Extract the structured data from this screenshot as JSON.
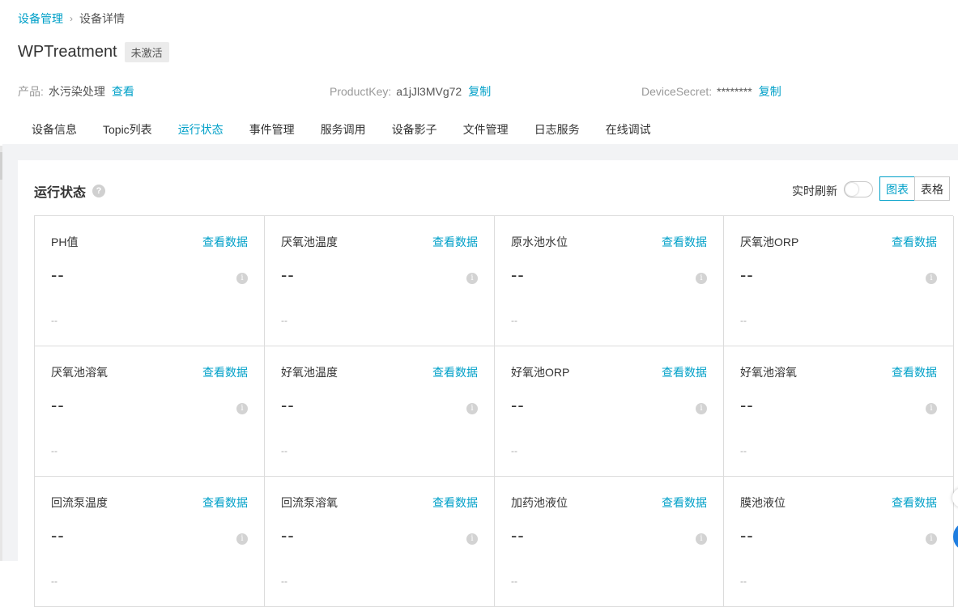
{
  "breadcrumb": {
    "parent": "设备管理",
    "current": "设备详情"
  },
  "device": {
    "name": "WPTreatment",
    "status": "未激活"
  },
  "meta": {
    "product_label": "产品:",
    "product_value": "水污染处理",
    "product_link": "查看",
    "productkey_label": "ProductKey:",
    "productkey_value": "a1jJl3MVg72",
    "productkey_link": "复制",
    "secret_label": "DeviceSecret:",
    "secret_value": "********",
    "secret_link": "复制"
  },
  "tabs": [
    {
      "label": "设备信息"
    },
    {
      "label": "Topic列表"
    },
    {
      "label": "运行状态"
    },
    {
      "label": "事件管理"
    },
    {
      "label": "服务调用"
    },
    {
      "label": "设备影子"
    },
    {
      "label": "文件管理"
    },
    {
      "label": "日志服务"
    },
    {
      "label": "在线调试"
    }
  ],
  "active_tab": 2,
  "section": {
    "title": "运行状态",
    "help_icon": "?",
    "refresh_label": "实时刷新",
    "refresh_on": false,
    "view_chart": "图表",
    "view_table": "表格"
  },
  "card_action": "查看数据",
  "cards": [
    {
      "name": "PH值",
      "value": "--",
      "sub": "--"
    },
    {
      "name": "厌氧池温度",
      "value": "--",
      "sub": "--"
    },
    {
      "name": "原水池水位",
      "value": "--",
      "sub": "--"
    },
    {
      "name": "厌氧池ORP",
      "value": "--",
      "sub": "--"
    },
    {
      "name": "厌氧池溶氧",
      "value": "--",
      "sub": "--"
    },
    {
      "name": "好氧池温度",
      "value": "--",
      "sub": "--"
    },
    {
      "name": "好氧池ORP",
      "value": "--",
      "sub": "--"
    },
    {
      "name": "好氧池溶氧",
      "value": "--",
      "sub": "--"
    },
    {
      "name": "回流泵温度",
      "value": "--",
      "sub": "--"
    },
    {
      "name": "回流泵溶氧",
      "value": "--",
      "sub": "--"
    },
    {
      "name": "加药池液位",
      "value": "--",
      "sub": "--"
    },
    {
      "name": "膜池液位",
      "value": "--",
      "sub": "--"
    }
  ],
  "colors": {
    "accent": "#00a0c8",
    "border": "#dcdcdc",
    "band": "#f2f3f5"
  }
}
